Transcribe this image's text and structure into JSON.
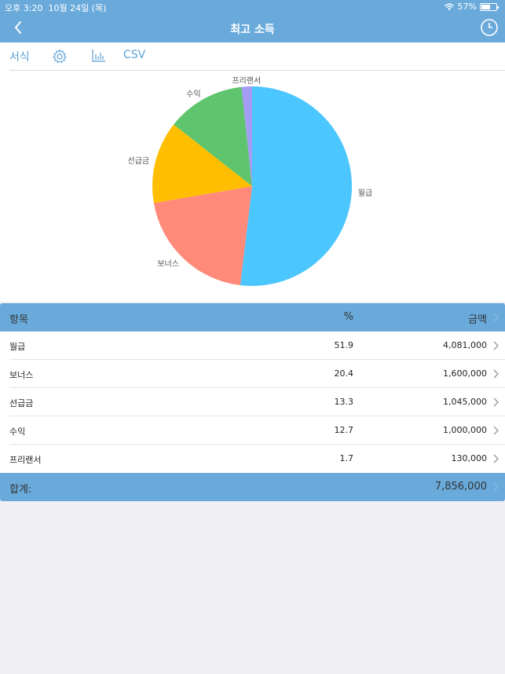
{
  "status": {
    "time": "오후 3:20",
    "date": "10월 24일 (목)",
    "battery": "57%"
  },
  "nav": {
    "title": "최고 소득"
  },
  "toolbar": {
    "format_label": "서식",
    "csv_label": "CSV"
  },
  "colors": {
    "header": "#6aaadb",
    "accent": "#5a9fd4",
    "월급": "#4cc6ff",
    "보너스": "#ff8a7a",
    "선급금": "#ffbf00",
    "수익": "#5ec46e",
    "프리랜서": "#a59cf5"
  },
  "table": {
    "headers": {
      "item": "항목",
      "percent": "%",
      "amount": "금액"
    },
    "rows": [
      {
        "item": "월급",
        "percent": "51.9",
        "amount": "4,081,000"
      },
      {
        "item": "보너스",
        "percent": "20.4",
        "amount": "1,600,000"
      },
      {
        "item": "선급금",
        "percent": "13.3",
        "amount": "1,045,000"
      },
      {
        "item": "수익",
        "percent": "12.7",
        "amount": "1,000,000"
      },
      {
        "item": "프리랜서",
        "percent": "1.7",
        "amount": "130,000"
      }
    ],
    "total_label": "합계:",
    "total_amount": "7,856,000"
  },
  "chart_data": {
    "type": "pie",
    "categories": [
      "월급",
      "보너스",
      "선급금",
      "수익",
      "프리랜서"
    ],
    "values": [
      51.9,
      20.4,
      13.3,
      12.7,
      1.7
    ]
  }
}
